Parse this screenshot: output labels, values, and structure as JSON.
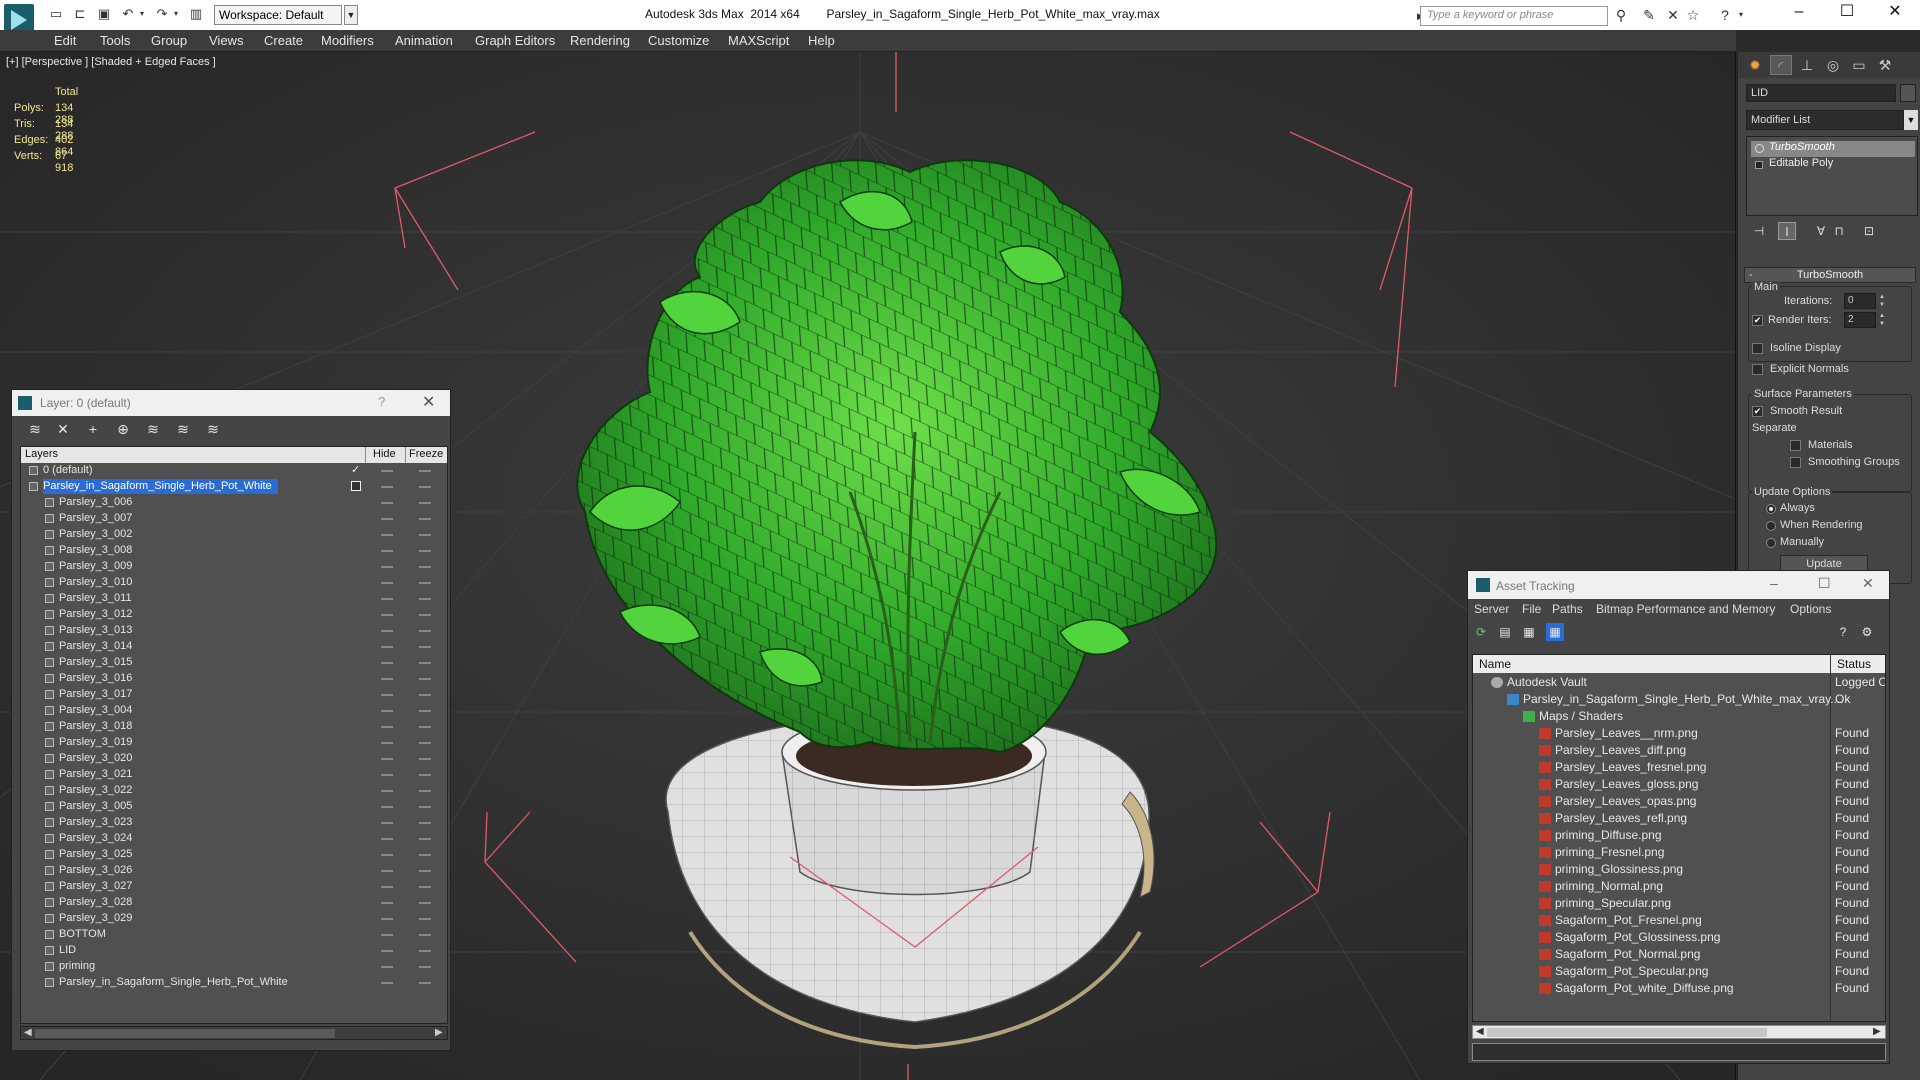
{
  "titlebar": {
    "app_title": "Autodesk 3ds Max  2014 x64",
    "file_name": "Parsley_in_Sagaform_Single_Herb_Pot_White_max_vray.max",
    "workspace": "Workspace: Default",
    "search_placeholder": "Type a keyword or phrase"
  },
  "menu": [
    "Edit",
    "Tools",
    "Group",
    "Views",
    "Create",
    "Modifiers",
    "Animation",
    "Graph Editors",
    "Rendering",
    "Customize",
    "MAXScript",
    "Help"
  ],
  "viewport": {
    "label": "[+] [Perspective ] [Shaded + Edged Faces ]",
    "stats": {
      "header": "Total",
      "polys_label": "Polys:",
      "polys": "134 288",
      "tris_label": "Tris:",
      "tris": "134 288",
      "edges_label": "Edges:",
      "edges": "402 864",
      "verts_label": "Verts:",
      "verts": "67 918"
    }
  },
  "command_panel": {
    "object_name": "LID",
    "modifier_list": "Modifier List",
    "stack": [
      "TurboSmooth",
      "Editable Poly"
    ],
    "rollout_title": "TurboSmooth",
    "main_group": "Main",
    "iterations_label": "Iterations:",
    "iterations": "0",
    "render_iters_label": "Render Iters:",
    "render_iters": "2",
    "render_iters_checked": true,
    "isoline_label": "Isoline Display",
    "explicit_normals_label": "Explicit Normals",
    "surface_group": "Surface Parameters",
    "smooth_result_label": "Smooth Result",
    "smooth_result_checked": true,
    "separate_label": "Separate",
    "materials_label": "Materials",
    "smoothing_groups_label": "Smoothing Groups",
    "update_group": "Update Options",
    "update_always": "Always",
    "update_when_rendering": "When Rendering",
    "update_manually": "Manually",
    "update_button": "Update"
  },
  "layer_dialog": {
    "title": "Layer: 0 (default)",
    "help": "?",
    "col_layers": "Layers",
    "col_hide": "Hide",
    "col_freeze": "Freeze",
    "layers": [
      {
        "name": "0 (default)",
        "level": 1,
        "active": true
      },
      {
        "name": "Parsley_in_Sagaform_Single_Herb_Pot_White",
        "level": 1,
        "selected": true
      },
      {
        "name": "Parsley_3_006",
        "level": 2
      },
      {
        "name": "Parsley_3_007",
        "level": 2
      },
      {
        "name": "Parsley_3_002",
        "level": 2
      },
      {
        "name": "Parsley_3_008",
        "level": 2
      },
      {
        "name": "Parsley_3_009",
        "level": 2
      },
      {
        "name": "Parsley_3_010",
        "level": 2
      },
      {
        "name": "Parsley_3_011",
        "level": 2
      },
      {
        "name": "Parsley_3_012",
        "level": 2
      },
      {
        "name": "Parsley_3_013",
        "level": 2
      },
      {
        "name": "Parsley_3_014",
        "level": 2
      },
      {
        "name": "Parsley_3_015",
        "level": 2
      },
      {
        "name": "Parsley_3_016",
        "level": 2
      },
      {
        "name": "Parsley_3_017",
        "level": 2
      },
      {
        "name": "Parsley_3_004",
        "level": 2
      },
      {
        "name": "Parsley_3_018",
        "level": 2
      },
      {
        "name": "Parsley_3_019",
        "level": 2
      },
      {
        "name": "Parsley_3_020",
        "level": 2
      },
      {
        "name": "Parsley_3_021",
        "level": 2
      },
      {
        "name": "Parsley_3_022",
        "level": 2
      },
      {
        "name": "Parsley_3_005",
        "level": 2
      },
      {
        "name": "Parsley_3_023",
        "level": 2
      },
      {
        "name": "Parsley_3_024",
        "level": 2
      },
      {
        "name": "Parsley_3_025",
        "level": 2
      },
      {
        "name": "Parsley_3_026",
        "level": 2
      },
      {
        "name": "Parsley_3_027",
        "level": 2
      },
      {
        "name": "Parsley_3_028",
        "level": 2
      },
      {
        "name": "Parsley_3_029",
        "level": 2
      },
      {
        "name": "BOTTOM",
        "level": 2
      },
      {
        "name": "LID",
        "level": 2
      },
      {
        "name": "priming",
        "level": 2
      },
      {
        "name": "Parsley_in_Sagaform_Single_Herb_Pot_White",
        "level": 2
      }
    ]
  },
  "asset_dialog": {
    "title": "Asset Tracking",
    "menu": [
      "Server",
      "File",
      "Paths",
      "Bitmap Performance and Memory",
      "Options"
    ],
    "col_name": "Name",
    "col_status": "Status",
    "rows": [
      {
        "name": "Autodesk Vault",
        "status": "Logged O",
        "level": 0,
        "icon": "vault"
      },
      {
        "name": "Parsley_in_Sagaform_Single_Herb_Pot_White_max_vray....",
        "status": "Ok",
        "level": 1,
        "icon": "max"
      },
      {
        "name": "Maps / Shaders",
        "status": "",
        "level": 2,
        "icon": "folder"
      },
      {
        "name": "Parsley_Leaves__nrm.png",
        "status": "Found",
        "level": 3,
        "icon": "png"
      },
      {
        "name": "Parsley_Leaves_diff.png",
        "status": "Found",
        "level": 3,
        "icon": "png"
      },
      {
        "name": "Parsley_Leaves_fresnel.png",
        "status": "Found",
        "level": 3,
        "icon": "png"
      },
      {
        "name": "Parsley_Leaves_gloss.png",
        "status": "Found",
        "level": 3,
        "icon": "png"
      },
      {
        "name": "Parsley_Leaves_opas.png",
        "status": "Found",
        "level": 3,
        "icon": "png"
      },
      {
        "name": "Parsley_Leaves_refl.png",
        "status": "Found",
        "level": 3,
        "icon": "png"
      },
      {
        "name": "priming_Diffuse.png",
        "status": "Found",
        "level": 3,
        "icon": "png"
      },
      {
        "name": "priming_Fresnel.png",
        "status": "Found",
        "level": 3,
        "icon": "png"
      },
      {
        "name": "priming_Glossiness.png",
        "status": "Found",
        "level": 3,
        "icon": "png"
      },
      {
        "name": "priming_Normal.png",
        "status": "Found",
        "level": 3,
        "icon": "png"
      },
      {
        "name": "priming_Specular.png",
        "status": "Found",
        "level": 3,
        "icon": "png"
      },
      {
        "name": "Sagaform_Pot_Fresnel.png",
        "status": "Found",
        "level": 3,
        "icon": "png"
      },
      {
        "name": "Sagaform_Pot_Glossiness.png",
        "status": "Found",
        "level": 3,
        "icon": "png"
      },
      {
        "name": "Sagaform_Pot_Normal.png",
        "status": "Found",
        "level": 3,
        "icon": "png"
      },
      {
        "name": "Sagaform_Pot_Specular.png",
        "status": "Found",
        "level": 3,
        "icon": "png"
      },
      {
        "name": "Sagaform_Pot_white_Diffuse.png",
        "status": "Found",
        "level": 3,
        "icon": "png"
      }
    ]
  },
  "colors": {
    "selection_blue": "#2a6cd6",
    "stats_yellow": "#f0e68c",
    "viewport_bg": "#2f2f2f",
    "leaf_green": "#3cc83c",
    "bounding_box": "#e05a6a"
  }
}
